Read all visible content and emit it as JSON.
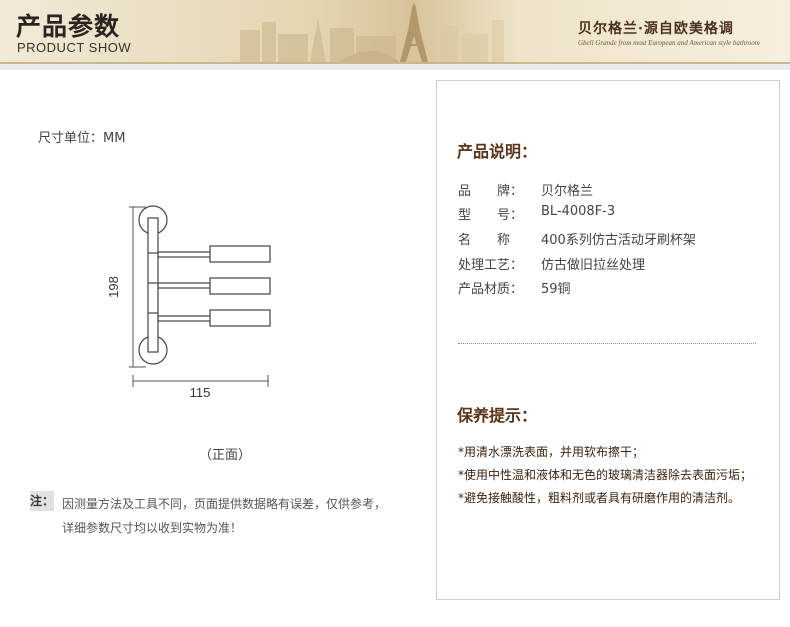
{
  "header": {
    "title": "产品参数",
    "subtitle": "PRODUCT SHOW",
    "brand": "贝尔格兰·源自欧美格调",
    "tagline": "Gbell Grande from most European and American style bathroom"
  },
  "drawing": {
    "unit_label": "尺寸单位：MM",
    "height_dim": "198",
    "width_dim": "115",
    "view_label": "（正面）"
  },
  "note": {
    "tag": "注：",
    "line1": "因测量方法及工具不同，页面提供数据略有误差，仅供参考，",
    "line2": "详细参数尺寸均以收到实物为准！"
  },
  "spec": {
    "title": "产品说明：",
    "rows": [
      {
        "label": "品　　牌：",
        "value": "贝尔格兰"
      },
      {
        "label": "型　　号：",
        "value": "BL-4008F-3"
      },
      {
        "label": "名　　称",
        "value": "400系列仿古活动牙刷杯架"
      },
      {
        "label": "处理工艺：",
        "value": "仿古做旧拉丝处理"
      },
      {
        "label": "产品材质：",
        "value": "59铜"
      }
    ]
  },
  "care": {
    "title": "保养提示：",
    "lines": [
      "*用清水漂洗表面，并用软布擦干；",
      "*使用中性温和液体和无色的玻璃清洁器除去表面污垢；",
      "*避免接触酸性，粗料剂或者具有研磨作用的清洁剂。"
    ]
  }
}
